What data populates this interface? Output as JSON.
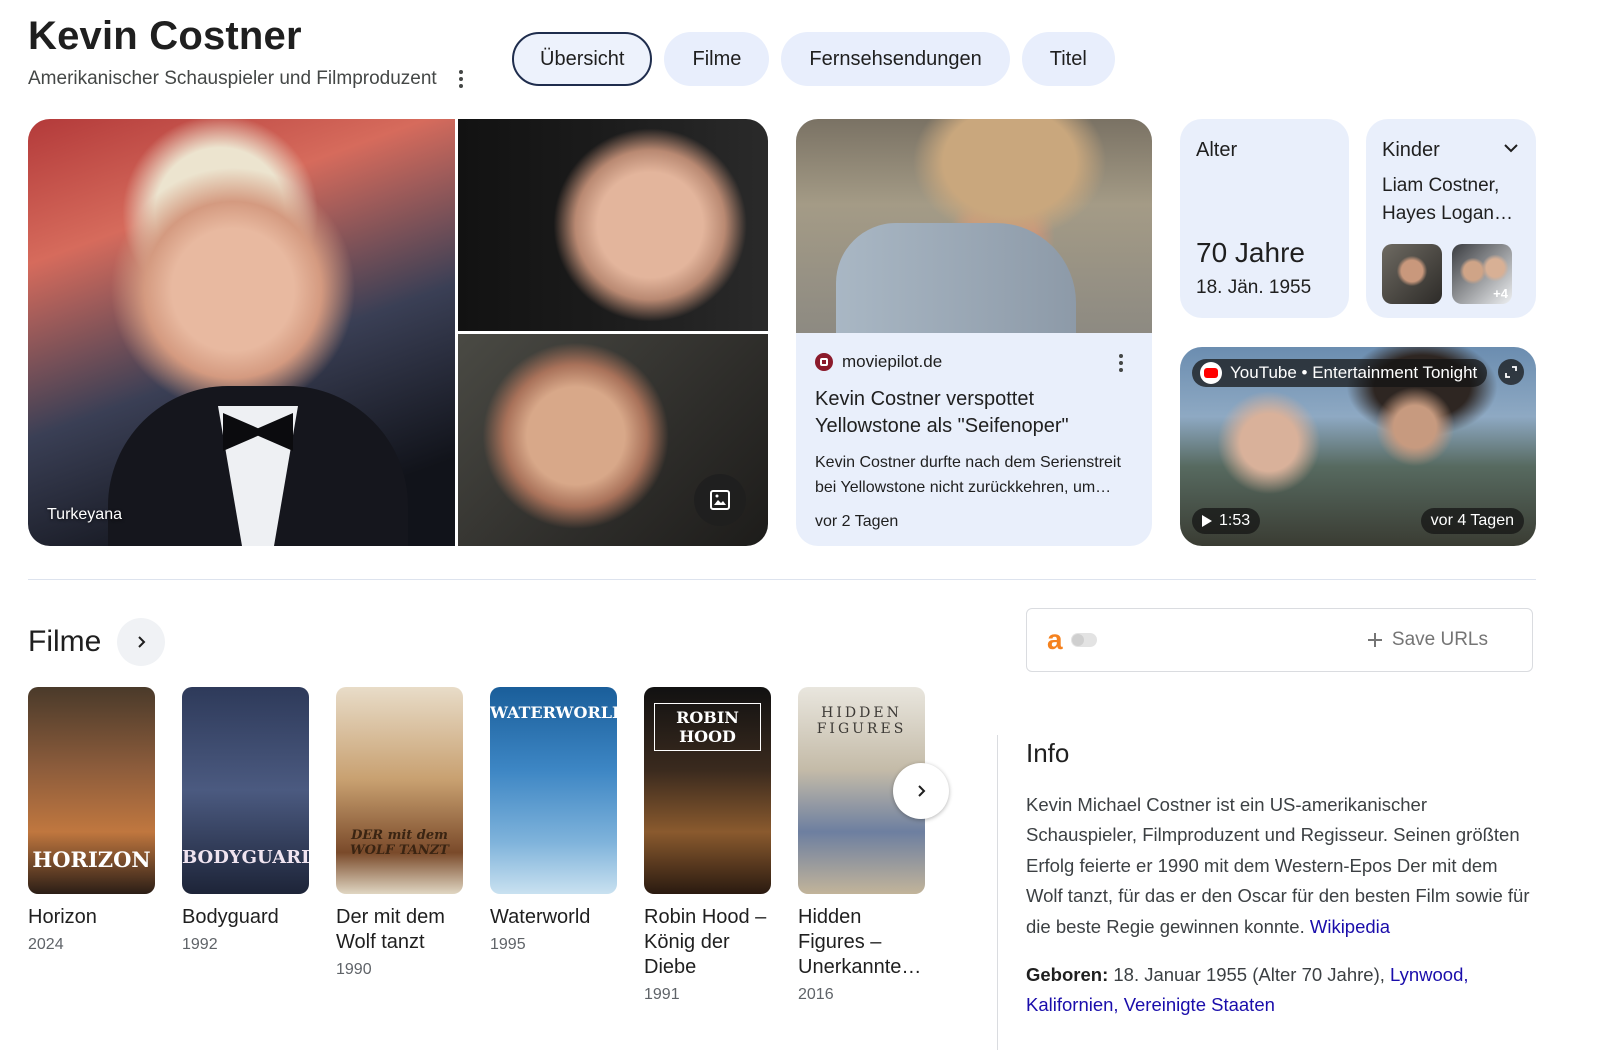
{
  "header": {
    "title": "Kevin Costner",
    "subtitle": "Amerikanischer Schauspieler und Filmproduzent"
  },
  "tabs": [
    {
      "label": "Übersicht",
      "active": true
    },
    {
      "label": "Filme",
      "active": false
    },
    {
      "label": "Fernsehsendungen",
      "active": false
    },
    {
      "label": "Titel",
      "active": false
    }
  ],
  "images": {
    "main_caption": "Turkeyana"
  },
  "news": {
    "source": "moviepilot.de",
    "title": "Kevin Costner verspottet Yellowstone als \"Seifenoper\"",
    "snippet": "Kevin Costner durfte nach dem Serienstreit bei Yellowstone nicht zurückkehren, um…",
    "time": "vor 2 Tagen"
  },
  "age": {
    "label": "Alter",
    "value": "70 Jahre",
    "date": "18. Jän. 1955"
  },
  "kids": {
    "label": "Kinder",
    "names": "Liam Costner, Hayes Logan…",
    "more": "+4"
  },
  "video": {
    "source": "YouTube • Entertainment Tonight",
    "duration": "1:53",
    "age": "vor 4 Tagen"
  },
  "films_section": {
    "title": "Filme",
    "items": [
      {
        "name": "Horizon",
        "year": "2024",
        "poster_text": "HORIZON"
      },
      {
        "name": "Bodyguard",
        "year": "1992",
        "poster_text": "BODYGUARD"
      },
      {
        "name": "Der mit dem Wolf tanzt",
        "year": "1990",
        "poster_text": "DER mit dem WOLF TANZT"
      },
      {
        "name": "Waterworld",
        "year": "1995",
        "poster_text": "WATERWORLD"
      },
      {
        "name": "Robin Hood – König der Diebe",
        "year": "1991",
        "poster_text": "ROBIN HOOD"
      },
      {
        "name": "Hidden Figures – Unerkannte…",
        "year": "2016",
        "poster_text": "HIDDEN FIGURES"
      }
    ]
  },
  "saveurls": {
    "logo": "a",
    "button_label": "Save URLs"
  },
  "info": {
    "title": "Info",
    "text": "Kevin Michael Costner ist ein US-amerikanischer Schauspieler, Filmproduzent und Regisseur. Seinen größten Erfolg feierte er 1990 mit dem Western-Epos Der mit dem Wolf tanzt, für das er den Oscar für den besten Film sowie für die beste Regie gewinnen konnte.",
    "source_link": "Wikipedia",
    "born_label": "Geboren:",
    "born_text": "18. Januar 1955 (Alter 70 Jahre),",
    "born_link": "Lynwood, Kalifornien, Vereinigte Staaten"
  },
  "colors": {
    "chip_bg": "#e8eefc",
    "card_bg": "#e9effb",
    "link": "#1a0dab",
    "amazon_orange": "#f5821f"
  }
}
